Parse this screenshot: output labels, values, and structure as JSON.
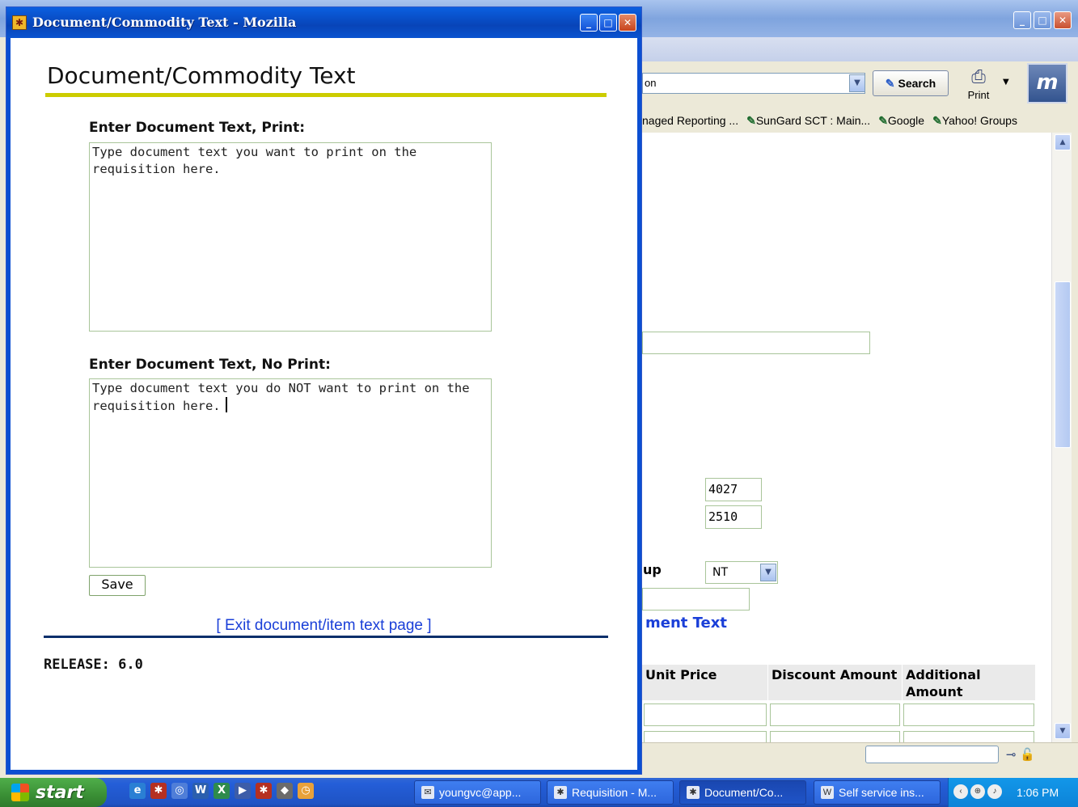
{
  "popup": {
    "window_title": "Document/Commodity Text - Mozilla",
    "heading": "Document/Commodity Text",
    "print_label": "Enter Document Text, Print:",
    "print_text": "Type document text you want to print on the requisition here.",
    "noprint_label": "Enter Document Text, No Print:",
    "noprint_text": "Type document text you do NOT want to print on the requisition here.",
    "save_label": "Save",
    "exit_link": "[ Exit document/item text page ]",
    "release": "RELEASE: 6.0"
  },
  "browser": {
    "url_fragment": "on",
    "search_label": "Search",
    "print_label": "Print",
    "bookmarks": [
      "naged Reporting ...",
      "SunGard SCT : Main...",
      "Google",
      "Yahoo! Groups"
    ],
    "fields": {
      "field_a": "4027",
      "field_b": "2510",
      "select_label": "up",
      "select_value": "NT",
      "link_text": "ment Text"
    },
    "table_headers": [
      "Unit Price",
      "Discount Amount",
      "Additional Amount"
    ]
  },
  "taskbar": {
    "start": "start",
    "tasks": [
      "youngvc@app...",
      "Requisition - M...",
      "Document/Co...",
      "Self service ins..."
    ],
    "clock": "1:06 PM"
  },
  "colors": {
    "heading_rule": "#cccc00",
    "footer_rule": "#0a2f6b",
    "link": "#1a3fd8",
    "title_bar": "#0a5fe0"
  }
}
